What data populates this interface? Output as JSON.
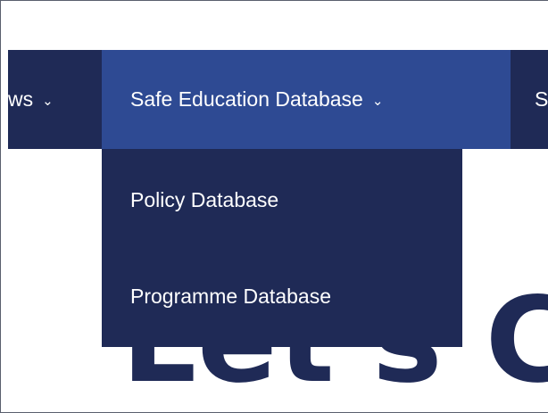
{
  "nav": {
    "items": [
      {
        "label": "ws",
        "chevron": "⌄"
      },
      {
        "label": "Safe Education Database",
        "chevron": "⌄"
      },
      {
        "label": "S"
      }
    ]
  },
  "dropdown": {
    "items": [
      {
        "label": "Policy Database"
      },
      {
        "label": "Programme Database"
      }
    ]
  },
  "hero": {
    "title": "Let's Ca"
  },
  "colors": {
    "nav_background": "#1f2a56",
    "nav_active": "#2e4a93",
    "hero_text": "#1f2a56",
    "text_light": "#ffffff"
  }
}
